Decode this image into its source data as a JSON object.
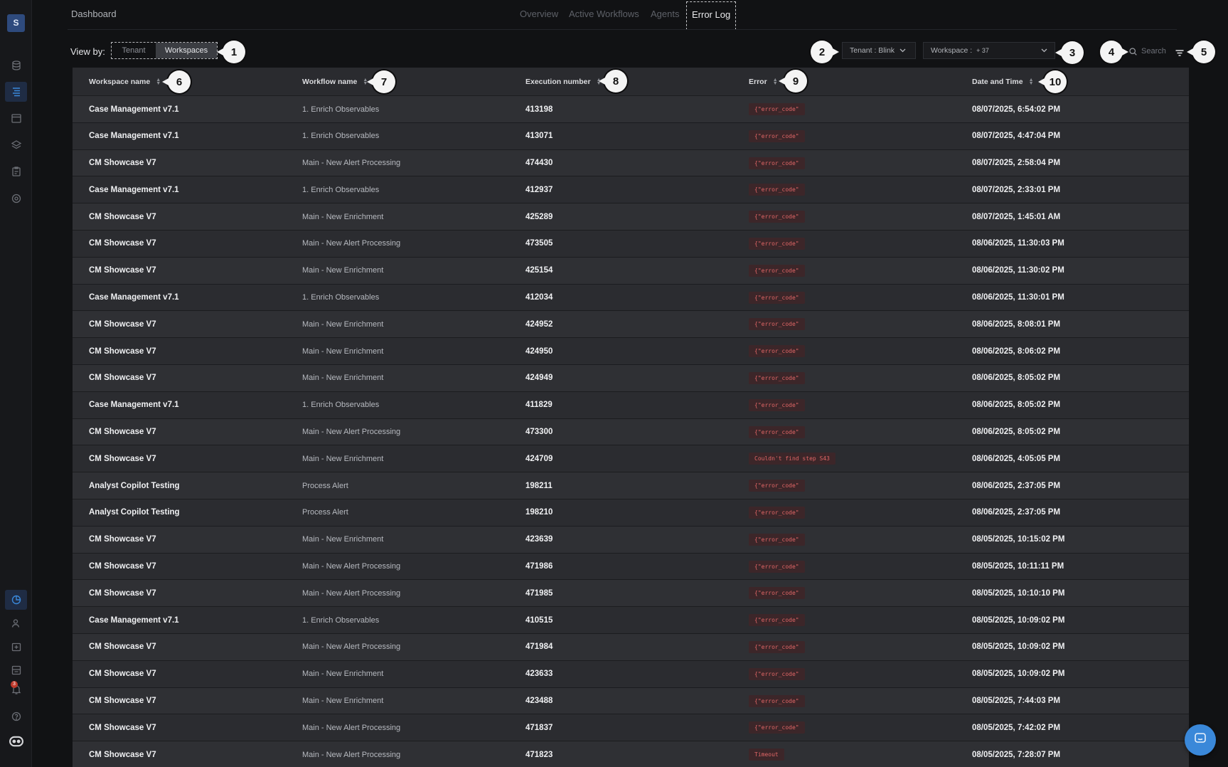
{
  "sidebar": {
    "logo_text": "S",
    "top_icons": [
      "database-icon",
      "workflows-icon",
      "calendar-icon",
      "layers-icon",
      "clipboard-icon",
      "target-icon"
    ],
    "bottom_icons": [
      "dashboard-icon",
      "users-icon",
      "add-case-icon",
      "archive-icon",
      "notifications-icon",
      "help-icon",
      "copilot-icon"
    ],
    "notification_count": "3",
    "accent": "#3a88d9"
  },
  "header": {
    "title": "Dashboard",
    "tabs": [
      {
        "label": "Overview"
      },
      {
        "label": "Active Workflows"
      },
      {
        "label": "Agents"
      },
      {
        "label": "Error Log"
      }
    ],
    "active_tab": "Error Log"
  },
  "controls": {
    "view_by_label": "View by:",
    "view_by_options": [
      "Tenant",
      "Workspaces"
    ],
    "view_by_selected": "Workspaces",
    "tenant_dropdown": "Tenant : Blink",
    "workspace_dropdown_label": "Workspace :",
    "workspace_dropdown_value": "+ 37",
    "search_placeholder": "Search"
  },
  "callouts": [
    "1",
    "2",
    "3",
    "4",
    "5",
    "6",
    "7",
    "8",
    "9",
    "10"
  ],
  "table": {
    "columns": [
      "Workspace name",
      "Workflow name",
      "Execution number",
      "Error",
      "Date and Time"
    ],
    "rows": [
      {
        "workspace": "Case Management v7.1",
        "workflow": "1. Enrich Observables",
        "execution": "413198",
        "error": "{\"error_code\"",
        "datetime": "08/07/2025, 6:54:02 PM"
      },
      {
        "workspace": "Case Management v7.1",
        "workflow": "1. Enrich Observables",
        "execution": "413071",
        "error": "{\"error_code\"",
        "datetime": "08/07/2025, 4:47:04 PM"
      },
      {
        "workspace": "CM Showcase V7",
        "workflow": "Main - New Alert Processing",
        "execution": "474430",
        "error": "{\"error_code\"",
        "datetime": "08/07/2025, 2:58:04 PM"
      },
      {
        "workspace": "Case Management v7.1",
        "workflow": "1. Enrich Observables",
        "execution": "412937",
        "error": "{\"error_code\"",
        "datetime": "08/07/2025, 2:33:01 PM"
      },
      {
        "workspace": "CM Showcase V7",
        "workflow": "Main - New Enrichment",
        "execution": "425289",
        "error": "{\"error_code\"",
        "datetime": "08/07/2025, 1:45:01 AM"
      },
      {
        "workspace": "CM Showcase V7",
        "workflow": "Main - New Alert Processing",
        "execution": "473505",
        "error": "{\"error_code\"",
        "datetime": "08/06/2025, 11:30:03 PM"
      },
      {
        "workspace": "CM Showcase V7",
        "workflow": "Main - New Enrichment",
        "execution": "425154",
        "error": "{\"error_code\"",
        "datetime": "08/06/2025, 11:30:02 PM"
      },
      {
        "workspace": "Case Management v7.1",
        "workflow": "1. Enrich Observables",
        "execution": "412034",
        "error": "{\"error_code\"",
        "datetime": "08/06/2025, 11:30:01 PM"
      },
      {
        "workspace": "CM Showcase V7",
        "workflow": "Main - New Enrichment",
        "execution": "424952",
        "error": "{\"error_code\"",
        "datetime": "08/06/2025, 8:08:01 PM"
      },
      {
        "workspace": "CM Showcase V7",
        "workflow": "Main - New Enrichment",
        "execution": "424950",
        "error": "{\"error_code\"",
        "datetime": "08/06/2025, 8:06:02 PM"
      },
      {
        "workspace": "CM Showcase V7",
        "workflow": "Main - New Enrichment",
        "execution": "424949",
        "error": "{\"error_code\"",
        "datetime": "08/06/2025, 8:05:02 PM"
      },
      {
        "workspace": "Case Management v7.1",
        "workflow": "1. Enrich Observables",
        "execution": "411829",
        "error": "{\"error_code\"",
        "datetime": "08/06/2025, 8:05:02 PM"
      },
      {
        "workspace": "CM Showcase V7",
        "workflow": "Main - New Alert Processing",
        "execution": "473300",
        "error": "{\"error_code\"",
        "datetime": "08/06/2025, 8:05:02 PM"
      },
      {
        "workspace": "CM Showcase V7",
        "workflow": "Main - New Enrichment",
        "execution": "424709",
        "error": "Couldn't find step S43",
        "datetime": "08/06/2025, 4:05:05 PM"
      },
      {
        "workspace": "Analyst Copilot Testing",
        "workflow": "Process Alert",
        "execution": "198211",
        "error": "{\"error_code\"",
        "datetime": "08/06/2025, 2:37:05 PM"
      },
      {
        "workspace": "Analyst Copilot Testing",
        "workflow": "Process Alert",
        "execution": "198210",
        "error": "{\"error_code\"",
        "datetime": "08/06/2025, 2:37:05 PM"
      },
      {
        "workspace": "CM Showcase V7",
        "workflow": "Main - New Enrichment",
        "execution": "423639",
        "error": "{\"error_code\"",
        "datetime": "08/05/2025, 10:15:02 PM"
      },
      {
        "workspace": "CM Showcase V7",
        "workflow": "Main - New Alert Processing",
        "execution": "471986",
        "error": "{\"error_code\"",
        "datetime": "08/05/2025, 10:11:11 PM"
      },
      {
        "workspace": "CM Showcase V7",
        "workflow": "Main - New Alert Processing",
        "execution": "471985",
        "error": "{\"error_code\"",
        "datetime": "08/05/2025, 10:10:10 PM"
      },
      {
        "workspace": "Case Management v7.1",
        "workflow": "1. Enrich Observables",
        "execution": "410515",
        "error": "{\"error_code\"",
        "datetime": "08/05/2025, 10:09:02 PM"
      },
      {
        "workspace": "CM Showcase V7",
        "workflow": "Main - New Alert Processing",
        "execution": "471984",
        "error": "{\"error_code\"",
        "datetime": "08/05/2025, 10:09:02 PM"
      },
      {
        "workspace": "CM Showcase V7",
        "workflow": "Main - New Enrichment",
        "execution": "423633",
        "error": "{\"error_code\"",
        "datetime": "08/05/2025, 10:09:02 PM"
      },
      {
        "workspace": "CM Showcase V7",
        "workflow": "Main - New Enrichment",
        "execution": "423488",
        "error": "{\"error_code\"",
        "datetime": "08/05/2025, 7:44:03 PM"
      },
      {
        "workspace": "CM Showcase V7",
        "workflow": "Main - New Alert Processing",
        "execution": "471837",
        "error": "{\"error_code\"",
        "datetime": "08/05/2025, 7:42:02 PM"
      },
      {
        "workspace": "CM Showcase V7",
        "workflow": "Main - New Alert Processing",
        "execution": "471823",
        "error": "Timeout",
        "datetime": "08/05/2025, 7:28:07 PM"
      }
    ]
  },
  "colors": {
    "background": "#111214",
    "table_row": "#2f3034",
    "error_text": "#e06666",
    "error_badge_bg": "#3c2629"
  }
}
